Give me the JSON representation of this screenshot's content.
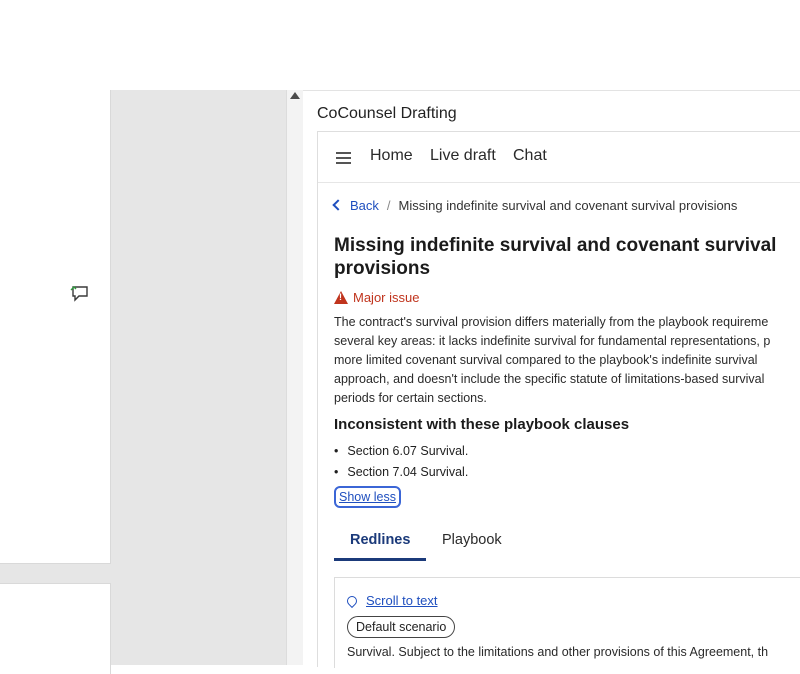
{
  "pane": {
    "title": "CoCounsel Drafting"
  },
  "nav": {
    "items": [
      "Home",
      "Live draft",
      "Chat"
    ]
  },
  "breadcrumb": {
    "back": "Back",
    "separator": "/",
    "current": "Missing indefinite survival and covenant survival provisions"
  },
  "issue": {
    "title": "Missing indefinite survival and covenant survival provisions",
    "severity": "Major issue",
    "description_lines": [
      "The contract's survival provision differs materially from the playbook requireme",
      "several key areas: it lacks indefinite survival for fundamental representations, p",
      "more limited covenant survival compared to the playbook's indefinite survival",
      "approach, and doesn't include the specific statute of limitations-based survival",
      "periods for certain sections."
    ],
    "clauses_heading": "Inconsistent with these playbook clauses",
    "clauses": [
      "Section 6.07 Survival.",
      "Section 7.04 Survival."
    ],
    "show_less": "Show less"
  },
  "tabs": {
    "redlines": "Redlines",
    "playbook": "Playbook"
  },
  "card": {
    "scroll_link": "Scroll to text",
    "scenario": "Default scenario",
    "text": "Survival. Subject to the limitations and other provisions of this Agreement, th"
  },
  "colors": {
    "link": "#1f4fbf",
    "severity": "#c0341d",
    "active_tab": "#1b3a7a"
  },
  "icons": {
    "menu": "hamburger-icon",
    "comment": "comment-icon",
    "warning": "warning-icon",
    "location": "location-pin-icon"
  }
}
